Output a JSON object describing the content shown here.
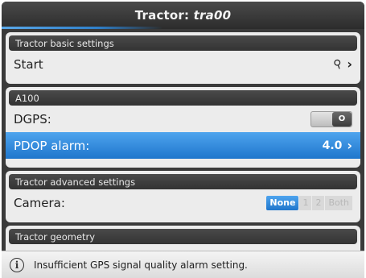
{
  "title": {
    "prefix": "Tractor:",
    "name": "tra00"
  },
  "sections": {
    "basic": {
      "header": "Tractor basic settings",
      "start_label": "Start",
      "start_icon": "pin-icon"
    },
    "a100": {
      "header": "A100",
      "dgps_label": "DGPS:",
      "dgps_toggle": "O",
      "pdop_label": "PDOP alarm:",
      "pdop_value": "4.0"
    },
    "advanced": {
      "header": "Tractor advanced settings",
      "camera_label": "Camera:",
      "camera_options": [
        "None",
        "1",
        "2",
        "Both"
      ],
      "camera_selected": "None"
    },
    "geometry": {
      "header": "Tractor geometry"
    }
  },
  "status": {
    "icon": "info-icon",
    "text": "Insufficient GPS signal quality alarm setting."
  },
  "colors": {
    "accent": "#2f86d8",
    "header_bg": "#3a3a3a"
  }
}
